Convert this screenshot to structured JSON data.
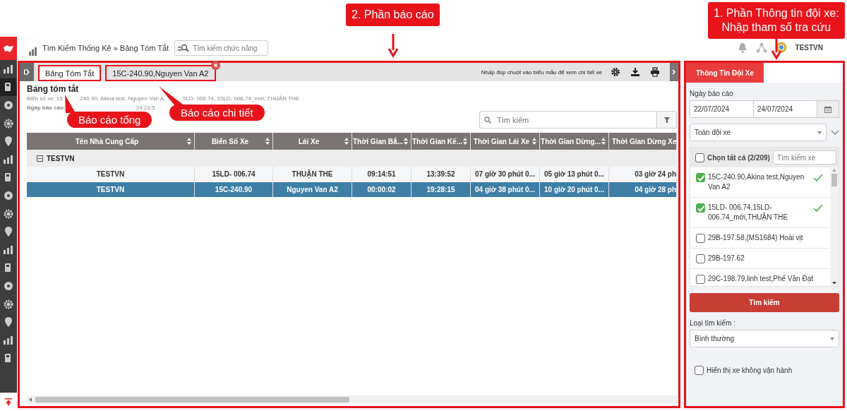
{
  "annotations": [
    {
      "kind": "box",
      "text": "2. Phần báo cáo"
    },
    {
      "kind": "box",
      "text": "1. Phần Thông tin đội xe:\nNhập tham số tra cứu"
    },
    {
      "kind": "bubble",
      "text": "Báo cáo tổng"
    },
    {
      "kind": "bubble",
      "text": "Báo cáo chi tiết"
    }
  ],
  "sidebar": {
    "items": [
      {
        "selected": false
      },
      {
        "selected": true
      },
      {
        "selected": false
      },
      {
        "selected": false
      },
      {
        "selected": false
      },
      {
        "selected": false
      },
      {
        "selected": false
      },
      {
        "selected": false
      },
      {
        "selected": false
      },
      {
        "selected": false
      },
      {
        "selected": false
      },
      {
        "selected": false
      },
      {
        "selected": false
      },
      {
        "selected": false
      },
      {
        "selected": false
      },
      {
        "selected": false
      },
      {
        "selected": false
      }
    ]
  },
  "breadcrumb": [
    "Tìm Kiếm Thống Kê",
    "»",
    "Bảng Tóm Tắt"
  ],
  "function_search": {
    "placeholder": "Tìm kiếm chức năng"
  },
  "user": {
    "name": "TESTVN"
  },
  "report": {
    "highlighted": true,
    "tabs": [
      {
        "label": "Bảng Tóm Tắt",
        "selected": true,
        "closable": false,
        "highlighted": true
      },
      {
        "label": "15C-240.90,Nguyen Van A2",
        "selected": false,
        "closable": true,
        "highlighted": true
      }
    ],
    "hint": "Nhấp đúp chuột vào biểu mẫu để xem chi tiết xe",
    "title": "Bảng tóm tắt",
    "info_lines": [
      [
        "Biển số xe: 15",
        "-240.90, Akina test, Nguyen Van A",
        "5LD- 006.74, 15LD- 006.74_mới, THUẬN THE"
      ],
      [
        "Ngày báo cáo:",
        "24 23:5"
      ]
    ],
    "search": {
      "placeholder": "Tìm kiếm"
    },
    "table": {
      "columns": [
        "Tên Nhà Cung Cấp",
        "Biển Số Xe",
        "Lái Xe",
        "Thời Gian Bắ...",
        "Thời Gian Kế...",
        "Thời Gian Lái Xe",
        "Thời Gian Dừng...",
        "Thời Gian Dừng Xe"
      ],
      "groups": [
        {
          "label": "TESTVN",
          "expanded": true,
          "rows": [
            {
              "selected": false,
              "cells": [
                "TESTVN",
                "15LD- 006.74",
                "THUẬN THE",
                "09:14:51",
                "13:39:52",
                "07 giờ 30 phút 0...",
                "05 giờ 13 phút 0...",
                "03 giờ 24 ph"
              ]
            },
            {
              "selected": true,
              "cells": [
                "TESTVN",
                "15C-240.90",
                "Nguyen Van A2",
                "00:00:02",
                "19:28:15",
                "04 giờ 38 phút 0...",
                "10 giờ 20 phút 0...",
                "04 giờ 28 ph"
              ]
            }
          ]
        }
      ]
    }
  },
  "fleet_panel": {
    "highlighted": true,
    "tab": {
      "label": "Thông Tin Đội Xe",
      "selected": true
    },
    "date_label": "Ngày báo cáo",
    "date_from": "22/07/2024",
    "date_to": "24/07/2024",
    "group_select": "Toàn đội xe",
    "select_all": {
      "label": "Chọn tất cả (2/209)",
      "checked": false
    },
    "vehicle_search": {
      "placeholder": "Tìm kiếm xe"
    },
    "vehicles": [
      {
        "label": "15C-240.90,Akina test,Nguyen Van A2",
        "checked": true
      },
      {
        "label": "15LD- 006.74,15LD- 006.74_mới,THUẬN THE",
        "checked": true
      },
      {
        "label": "29B-197.58,(MS1684) Hoài vịt",
        "checked": false
      },
      {
        "label": "29B-197.62",
        "checked": false
      },
      {
        "label": "29C-198.79,linh test,Phế Văn Đạt",
        "checked": false
      }
    ],
    "search_button": "Tìm kiếm",
    "type_label": "Loại tìm kiếm :",
    "type_select": "Bình thường",
    "show_inactive": {
      "label": "Hiển thị xe không vận hành",
      "checked": false
    }
  }
}
